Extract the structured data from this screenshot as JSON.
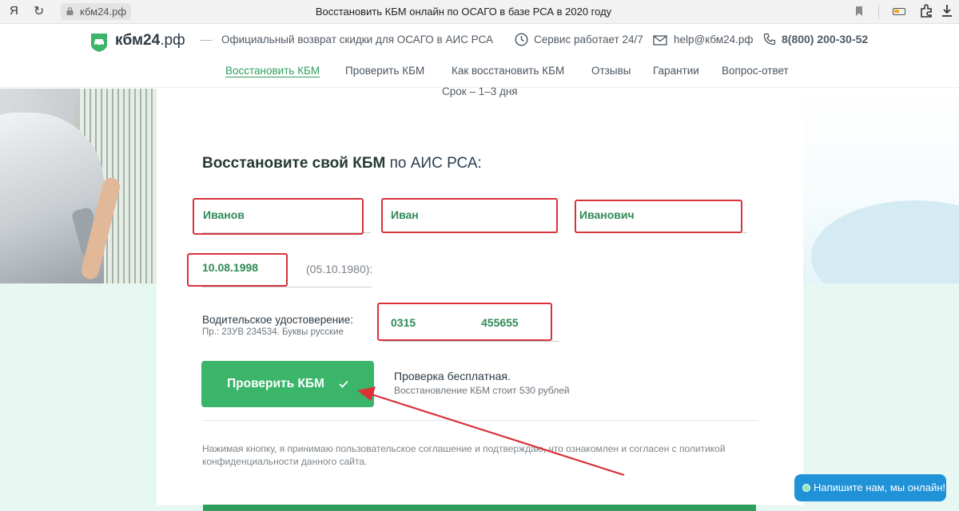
{
  "browser": {
    "logo_glyph": "Я",
    "url": "кбм24.рф",
    "tab_title": "Восстановить КБМ онлайн по ОСАГО в базе РСА в 2020 году"
  },
  "header": {
    "logo": {
      "name": "кбм24",
      "suffix": ".рф"
    },
    "tagline": "Официальный возврат скидки для ОСАГО в АИС РСА",
    "service_hours": "Сервис работает 24/7",
    "email": "help@кбм24.рф",
    "phone": "8(800) 200-30-52"
  },
  "nav": {
    "items": [
      {
        "label": "Восстановить КБМ",
        "active": true
      },
      {
        "label": "Проверить КБМ"
      },
      {
        "label": "Как восстановить КБМ"
      },
      {
        "label": "Отзывы"
      },
      {
        "label": "Гарантии"
      },
      {
        "label": "Вопрос-ответ"
      }
    ]
  },
  "hero": {
    "term": "Срок – 1–3 дня"
  },
  "form": {
    "title_bold": "Восстановите свой КБМ",
    "title_rest": " по АИС РСА:",
    "last_name": "Иванов",
    "first_name": "Иван",
    "middle_name": "Иванович",
    "birth_date": "10.08.1998",
    "birth_date_hint": "(05.10.1980):",
    "license_label": "Водительское удостоверение:",
    "license_hint": "Пр.: 23УВ 234534. Буквы русские",
    "license_series": "0315",
    "license_number": "455655",
    "submit_label": "Проверить КБМ",
    "free_note": "Проверка бесплатная.",
    "price_note": "Восстановление КБМ стоит 530 рублей",
    "consent": "Нажимая кнопку, я принимаю пользовательское соглашение и подтверждаю, что ознакомлен и согласен с политикой конфиденциальности данного сайта."
  },
  "chat": {
    "label": "Напишите нам, мы онлайн!"
  },
  "colors": {
    "brand_green": "#3ab56a",
    "nav_active": "#2f9e5c",
    "highlight_red": "#d9323b",
    "chat_blue": "#2092d8"
  }
}
